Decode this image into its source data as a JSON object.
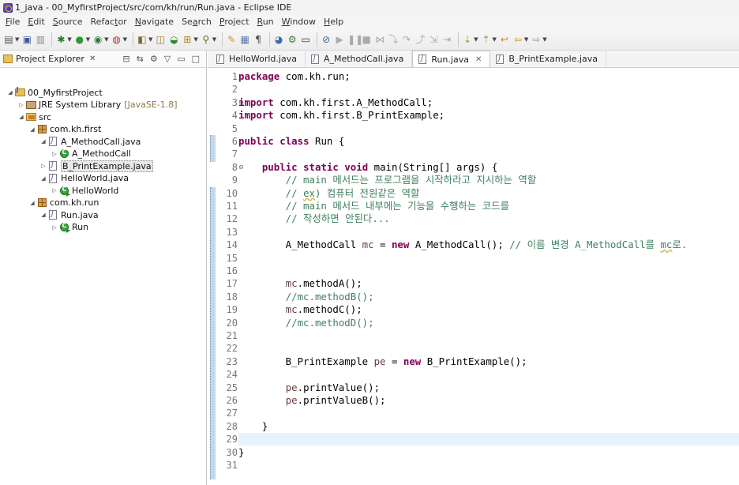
{
  "window": {
    "title": "1_java - 00_MyfirstProject/src/com/kh/run/Run.java - Eclipse IDE"
  },
  "menu": [
    {
      "m": "F",
      "r": "ile"
    },
    {
      "m": "E",
      "r": "dit"
    },
    {
      "m": "S",
      "r": "ource"
    },
    {
      "m": "",
      "r": "Refac",
      "m2": "t",
      "r2": "or"
    },
    {
      "m": "N",
      "r": "avigate"
    },
    {
      "m": "",
      "r": "Se",
      "m2": "a",
      "r2": "rch"
    },
    {
      "m": "P",
      "r": "roject"
    },
    {
      "m": "R",
      "r": "un"
    },
    {
      "m": "W",
      "r": "indow"
    },
    {
      "m": "H",
      "r": "elp"
    }
  ],
  "toolbar_icons": [
    "new-icon",
    "save-icon",
    "save-all-icon",
    "debug-icon",
    "run-icon",
    "coverage-icon",
    "external-tools-icon",
    "new-java-project-icon",
    "new-package-icon",
    "new-class-icon",
    "open-type-icon",
    "search-icon",
    "toggle-mark-occurrences-icon",
    "block-selection-icon",
    "show-whitespace-icon",
    "globe-icon",
    "open-task-icon",
    "terminal-icon",
    "skip-breakpoints-icon",
    "resume-icon",
    "suspend-icon",
    "terminate-icon",
    "disconnect-icon",
    "step-into-icon",
    "step-over-icon",
    "step-return-icon",
    "drop-to-frame-icon",
    "use-step-filters-icon",
    "next-annotation-icon",
    "previous-annotation-icon",
    "last-edit-icon",
    "back-icon",
    "forward-icon"
  ],
  "explorer": {
    "title": "Project Explorer",
    "tree": [
      {
        "label": "00_MyfirstProject",
        "icon": "project",
        "depth": 0,
        "twisty": "open"
      },
      {
        "label": "JRE System Library",
        "decor": "[JavaSE-1.8]",
        "icon": "library",
        "depth": 1,
        "twisty": "closed"
      },
      {
        "label": "src",
        "icon": "source-folder",
        "depth": 1,
        "twisty": "open"
      },
      {
        "label": "com.kh.first",
        "icon": "package",
        "depth": 2,
        "twisty": "open"
      },
      {
        "label": "A_MethodCall.java",
        "icon": "java-file",
        "depth": 3,
        "twisty": "open"
      },
      {
        "label": "A_MethodCall",
        "icon": "class",
        "depth": 4,
        "twisty": "closed"
      },
      {
        "label": "B_PrintExample.java",
        "icon": "java-file",
        "depth": 3,
        "twisty": "closed",
        "selected": true
      },
      {
        "label": "HelloWorld.java",
        "icon": "java-file",
        "depth": 3,
        "twisty": "open"
      },
      {
        "label": "HelloWorld",
        "icon": "class-main",
        "depth": 4,
        "twisty": "closed"
      },
      {
        "label": "com.kh.run",
        "icon": "package",
        "depth": 2,
        "twisty": "open"
      },
      {
        "label": "Run.java",
        "icon": "java-file",
        "depth": 3,
        "twisty": "open"
      },
      {
        "label": "Run",
        "icon": "class-main",
        "depth": 4,
        "twisty": "closed"
      }
    ]
  },
  "editor": {
    "tabs": [
      {
        "label": "HelloWorld.java",
        "active": false
      },
      {
        "label": "A_MethodCall.java",
        "active": false
      },
      {
        "label": "Run.java",
        "active": true
      },
      {
        "label": "B_PrintExample.java",
        "active": false
      }
    ],
    "current_line": 29,
    "lines": [
      {
        "n": "1",
        "fold": "",
        "t": [
          [
            "kw",
            "package"
          ],
          [
            "",
            "com.kh.run;"
          ]
        ]
      },
      {
        "n": "2",
        "fold": "",
        "t": []
      },
      {
        "n": "3",
        "fold": "⊖",
        "t": [
          [
            "kw",
            "import"
          ],
          [
            "",
            "com.kh.first.A_MethodCall;"
          ]
        ]
      },
      {
        "n": "4",
        "fold": "",
        "t": [
          [
            "kw",
            "import"
          ],
          [
            "",
            "com.kh.first.B_PrintExample;"
          ]
        ]
      },
      {
        "n": "5",
        "fold": "",
        "t": []
      },
      {
        "n": "6",
        "fold": "",
        "t": [
          [
            "kw",
            "public"
          ],
          [
            "kw",
            "class"
          ],
          [
            "",
            "Run {"
          ]
        ]
      },
      {
        "n": "7",
        "fold": "",
        "t": []
      },
      {
        "n": "8",
        "fold": "⊖",
        "t": [
          [
            "",
            "    "
          ],
          [
            "kw",
            "public"
          ],
          [
            "kw",
            "static"
          ],
          [
            "kw",
            "void"
          ],
          [
            "",
            "main(String[] args) {"
          ]
        ]
      },
      {
        "n": "9",
        "fold": "",
        "t": [
          [
            "cm",
            "        // main 메서드는 프로그램을 시작하라고 지시하는 역할"
          ]
        ]
      },
      {
        "n": "10",
        "fold": "",
        "t": [
          [
            "cm",
            "        // "
          ],
          [
            "cmsq",
            "ex"
          ],
          [
            "cm",
            ") 컴퓨터 전원같은 역할"
          ]
        ]
      },
      {
        "n": "11",
        "fold": "",
        "t": [
          [
            "cm",
            "        // main 메서드 내부에는 기능을 수행하는 코드를"
          ]
        ]
      },
      {
        "n": "12",
        "fold": "",
        "t": [
          [
            "cm",
            "        // 작성하면 안된다..."
          ]
        ]
      },
      {
        "n": "13",
        "fold": "",
        "t": []
      },
      {
        "n": "14",
        "fold": "",
        "t": [
          [
            "",
            "        A_MethodCall "
          ],
          [
            "var",
            "mc"
          ],
          [
            "",
            " = "
          ],
          [
            "kw",
            "new"
          ],
          [
            "",
            " A_MethodCall(); "
          ],
          [
            "cm",
            "// 이름 변경 A_MethodCall를 "
          ],
          [
            "cmsq",
            "mc"
          ],
          [
            "cm",
            "로."
          ]
        ]
      },
      {
        "n": "15",
        "fold": "",
        "t": []
      },
      {
        "n": "16",
        "fold": "",
        "t": []
      },
      {
        "n": "17",
        "fold": "",
        "t": [
          [
            "",
            "        "
          ],
          [
            "var",
            "mc"
          ],
          [
            "",
            ".methodA();"
          ]
        ]
      },
      {
        "n": "18",
        "fold": "",
        "t": [
          [
            "cm",
            "        //mc.methodB();"
          ]
        ]
      },
      {
        "n": "19",
        "fold": "",
        "t": [
          [
            "",
            "        "
          ],
          [
            "var",
            "mc"
          ],
          [
            "",
            ".methodC();"
          ]
        ]
      },
      {
        "n": "20",
        "fold": "",
        "t": [
          [
            "cm",
            "        //mc.methodD();"
          ]
        ]
      },
      {
        "n": "21",
        "fold": "",
        "t": []
      },
      {
        "n": "22",
        "fold": "",
        "t": []
      },
      {
        "n": "23",
        "fold": "",
        "t": [
          [
            "",
            "        B_PrintExample "
          ],
          [
            "var",
            "pe"
          ],
          [
            "",
            " = "
          ],
          [
            "kw",
            "new"
          ],
          [
            "",
            " B_PrintExample();"
          ]
        ]
      },
      {
        "n": "24",
        "fold": "",
        "t": []
      },
      {
        "n": "25",
        "fold": "",
        "t": [
          [
            "",
            "        "
          ],
          [
            "var",
            "pe"
          ],
          [
            "",
            ".printValue();"
          ]
        ]
      },
      {
        "n": "26",
        "fold": "",
        "t": [
          [
            "",
            "        "
          ],
          [
            "var",
            "pe"
          ],
          [
            "",
            ".printValueB();"
          ]
        ]
      },
      {
        "n": "27",
        "fold": "",
        "t": []
      },
      {
        "n": "28",
        "fold": "",
        "t": [
          [
            "",
            "    }"
          ]
        ]
      },
      {
        "n": "29",
        "fold": "",
        "t": []
      },
      {
        "n": "30",
        "fold": "",
        "t": [
          [
            "",
            "}"
          ]
        ]
      },
      {
        "n": "31",
        "fold": "",
        "t": []
      }
    ]
  }
}
